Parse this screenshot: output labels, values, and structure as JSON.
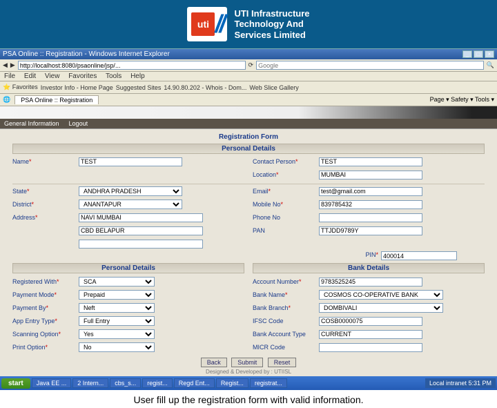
{
  "banner": {
    "logo_text": "uti",
    "company_line1": "UTI Infrastructure",
    "company_line2": "Technology And",
    "company_line3": "Services Limited"
  },
  "browser": {
    "title": "PSA Online :: Registration - Windows Internet Explorer",
    "url": "http://localhost:8080/psaonline/jsp/...",
    "search_placeholder": "Google",
    "menu": [
      "File",
      "Edit",
      "View",
      "Favorites",
      "Tools",
      "Help"
    ],
    "fav_label": "Favorites",
    "links": [
      "Investor Info - Home Page",
      "Suggested Sites",
      "14.90.80.202 - Whois - Dom...",
      "Web Slice Gallery"
    ],
    "tab": "PSA Online :: Registration",
    "tools": "Page ▾  Safety ▾  Tools ▾"
  },
  "nav": {
    "item1": "General Information",
    "item2": "Logout"
  },
  "form": {
    "title": "Registration Form",
    "sec_personal": "Personal Details",
    "sec_bank": "Bank Details",
    "labels": {
      "name": "Name",
      "contact": "Contact Person",
      "location": "Location",
      "state": "State",
      "email": "Email",
      "district": "District",
      "mobile": "Mobile No",
      "address": "Address",
      "phone": "Phone No",
      "pan": "PAN",
      "pin": "PIN",
      "regwith": "Registered With",
      "paymode": "Payment Mode",
      "payby": "Payment By",
      "apptype": "App Entry Type",
      "scanopt": "Scanning Option",
      "printopt": "Print Option",
      "acctno": "Account Number",
      "bankname": "Bank Name",
      "branch": "Bank Branch",
      "ifsc": "IFSC Code",
      "accttype": "Bank Account Type",
      "micr": "MICR Code"
    },
    "values": {
      "name": "TEST",
      "contact": "TEST",
      "location": "MUMBAI",
      "state": "ANDHRA PRADESH",
      "email": "test@gmail.com",
      "district": "ANANTAPUR",
      "mobile": "839785432",
      "address1": "NAVI MUMBAI",
      "address2": "CBD BELAPUR",
      "address3": "",
      "phone": "",
      "pan": "TTJDD9789Y",
      "pin": "400014",
      "regwith": "SCA",
      "paymode": "Prepaid",
      "payby": "Neft",
      "apptype": "Full Entry",
      "scanopt": "Yes",
      "printopt": "No",
      "acctno": "9783525245",
      "bankname": "COSMOS CO-OPERATIVE BANK",
      "branch": "DOMBIVALI",
      "ifsc": "COSB0000075",
      "accttype": "CURRENT",
      "micr": ""
    },
    "buttons": {
      "back": "Back",
      "submit": "Submit",
      "reset": "Reset"
    },
    "devby": "Designed & Developed by : UTIISL"
  },
  "taskbar": {
    "start": "start",
    "items": [
      "Java EE ...",
      "2 Intern...",
      "cbs_s...",
      "regist...",
      "Regd Ent...",
      "Regist...",
      "registrat..."
    ],
    "tray": "Local intranet   5:31 PM"
  },
  "caption": "User fill up the registration form with valid information."
}
